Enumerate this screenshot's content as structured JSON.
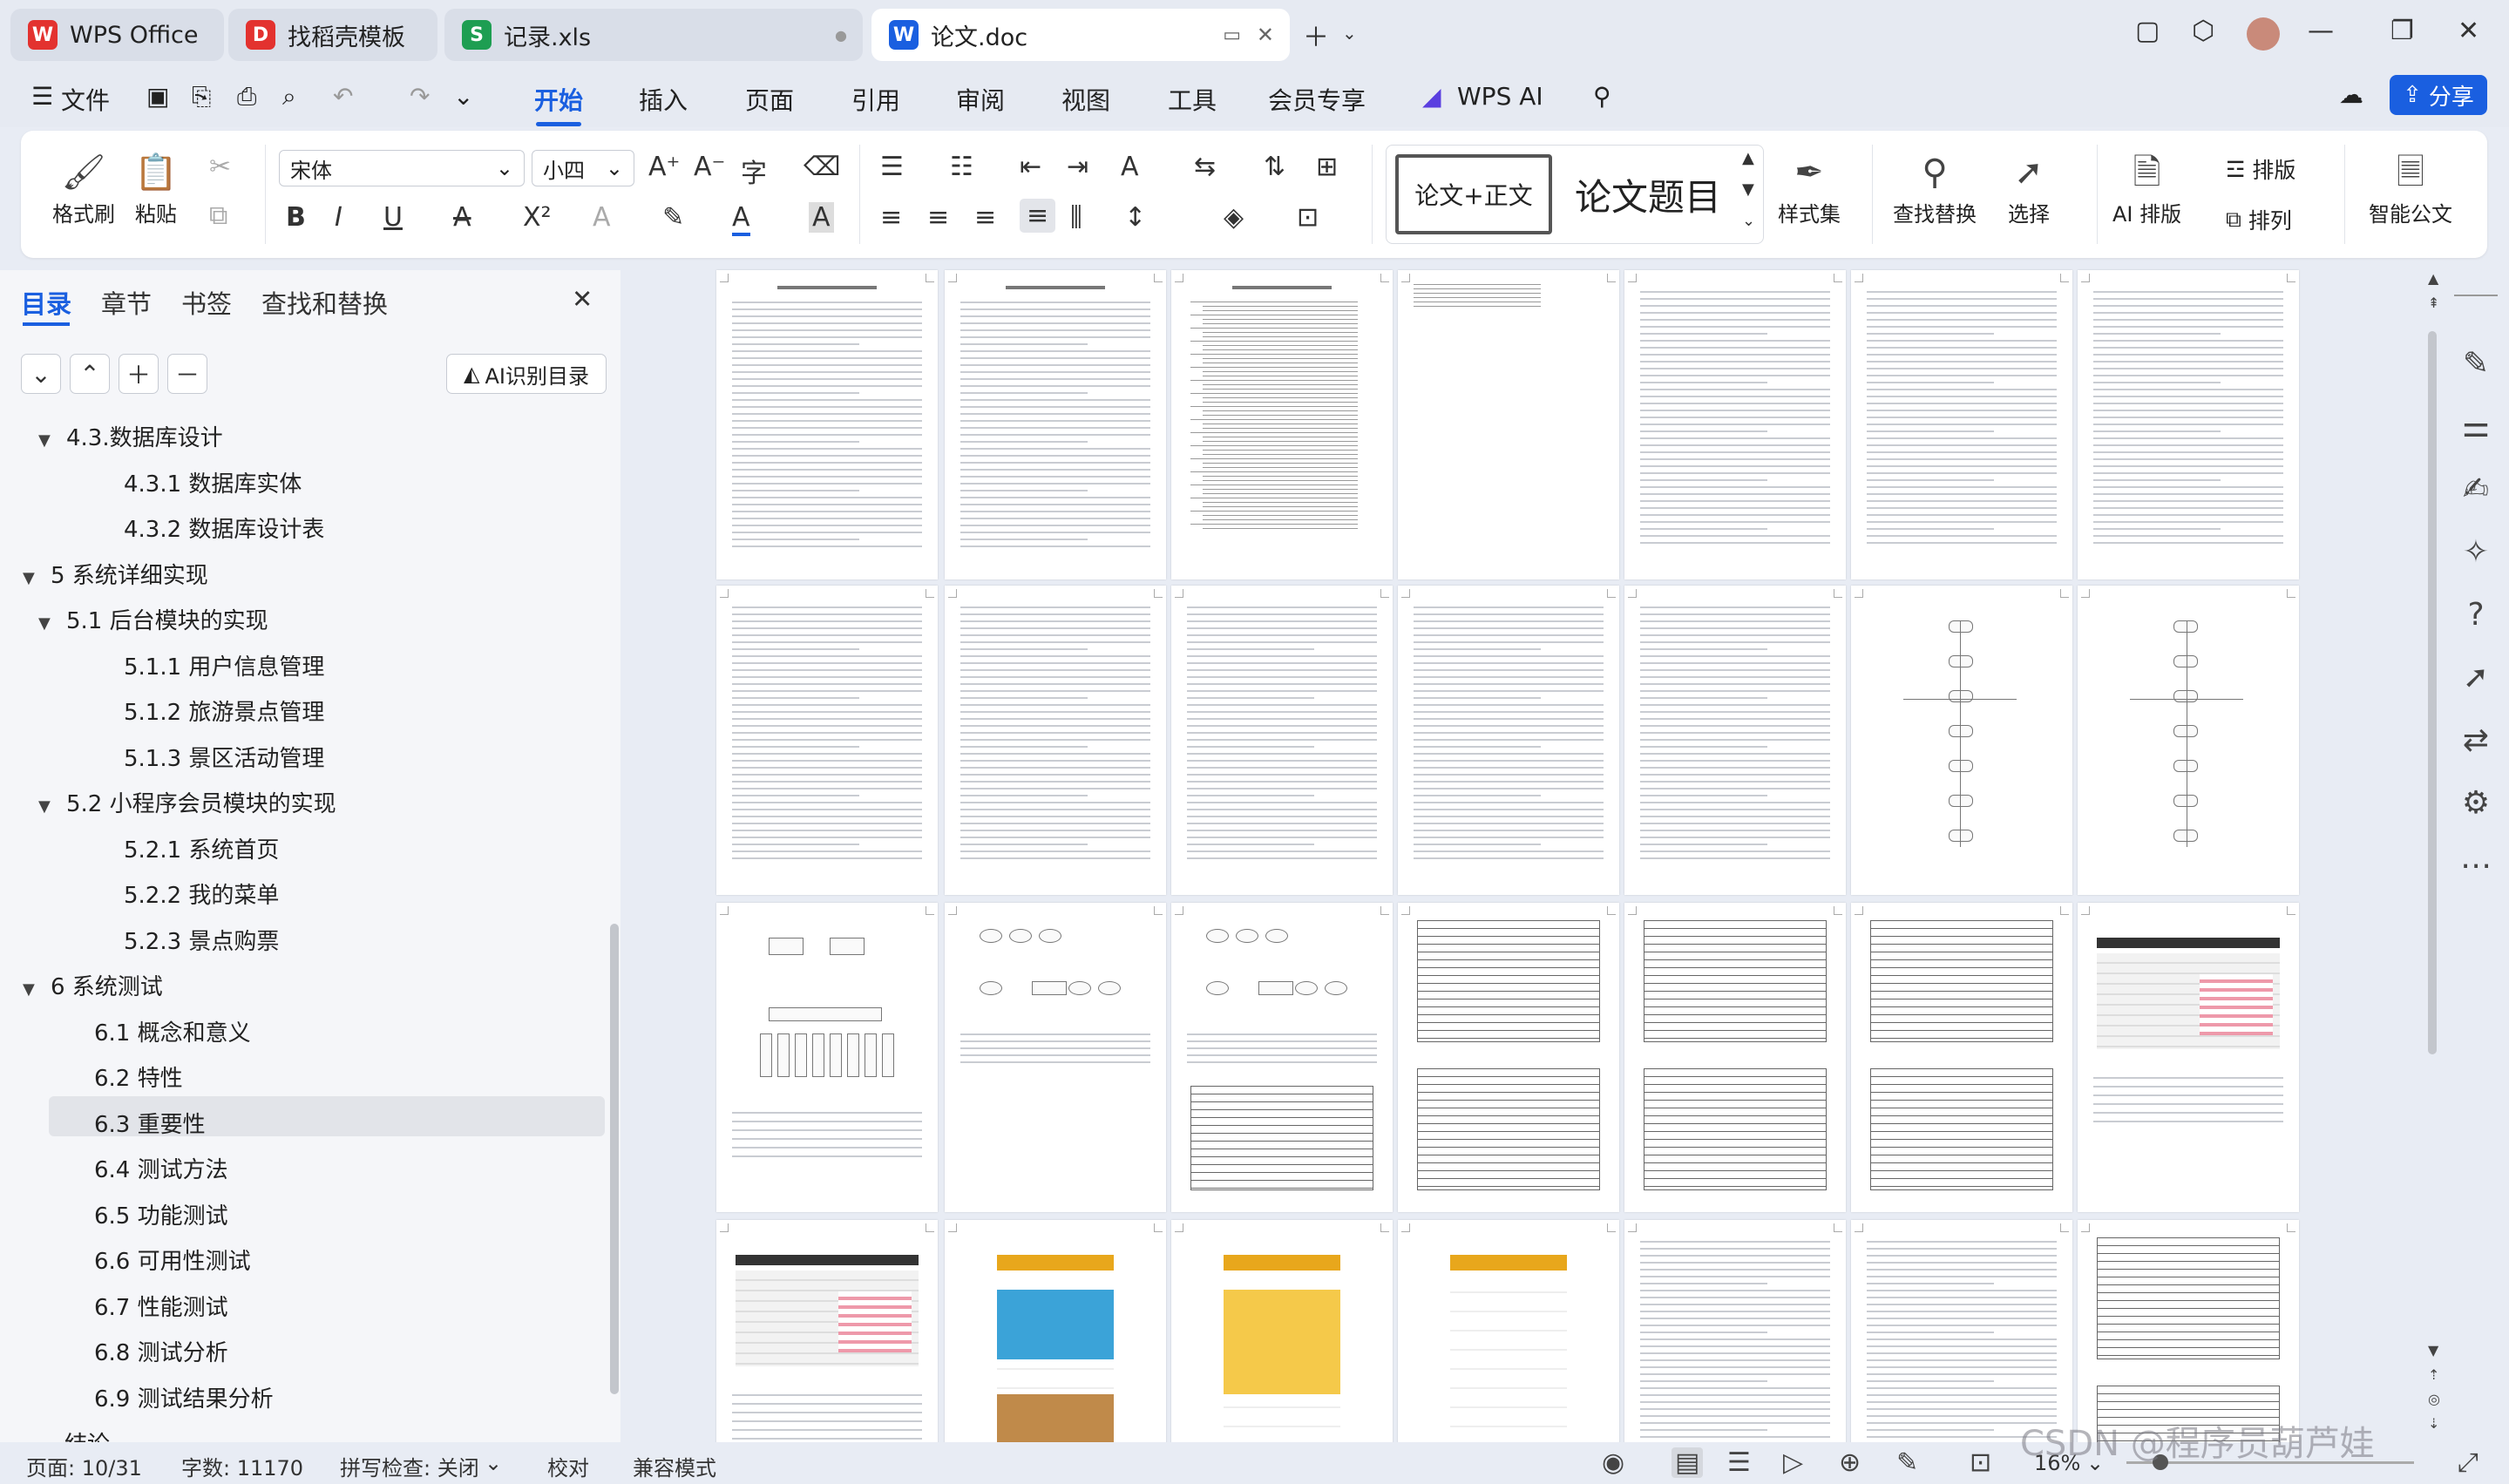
{
  "tabs": [
    {
      "label": "WPS Office",
      "icon": "W",
      "color": "#e3322f"
    },
    {
      "label": "找稻壳模板",
      "icon": "D",
      "color": "#e3322f"
    },
    {
      "label": "记录.xls",
      "icon": "S",
      "color": "#1e9e52"
    },
    {
      "label": "论文.doc",
      "icon": "W",
      "color": "#1a5fe0"
    }
  ],
  "menu": {
    "file": "文件",
    "items": [
      "开始",
      "插入",
      "页面",
      "引用",
      "审阅",
      "视图",
      "工具",
      "会员专享"
    ],
    "wps_ai": "WPS AI",
    "share": "分享"
  },
  "ribbon": {
    "format_painter": "格式刷",
    "paste": "粘贴",
    "font_name": "宋体",
    "font_size": "小四",
    "style_normal": "论文+正文",
    "style_title": "论文题目",
    "styles": "样式集",
    "find_replace": "查找替换",
    "select": "选择",
    "ai_layout": "AI 排版",
    "layout": "排版",
    "arrange": "排列",
    "smart_doc": "智能公文"
  },
  "sidebar": {
    "tabs": [
      "目录",
      "章节",
      "书签",
      "查找和替换"
    ],
    "ai_toc": "AI识别目录",
    "items": [
      {
        "label": "4.3.数据库设计",
        "level": 1,
        "toggle": "▼"
      },
      {
        "label": "4.3.1 数据库实体",
        "level": 2,
        "toggle": ""
      },
      {
        "label": "4.3.2 数据库设计表",
        "level": 2,
        "toggle": ""
      },
      {
        "label": "5 系统详细实现",
        "level": 0,
        "toggle": "▼"
      },
      {
        "label": "5.1  后台模块的实现",
        "level": 1,
        "toggle": "▼"
      },
      {
        "label": "5.1.1  用户信息管理",
        "level": 2,
        "toggle": ""
      },
      {
        "label": "5.1.2  旅游景点管理",
        "level": 2,
        "toggle": ""
      },
      {
        "label": "5.1.3  景区活动管理",
        "level": 2,
        "toggle": ""
      },
      {
        "label": "5.2  小程序会员模块的实现",
        "level": 1,
        "toggle": "▼"
      },
      {
        "label": "5.2.1  系统首页",
        "level": 2,
        "toggle": ""
      },
      {
        "label": "5.2.2  我的菜单",
        "level": 2,
        "toggle": ""
      },
      {
        "label": "5.2.3  景点购票",
        "level": 2,
        "toggle": ""
      },
      {
        "label": "6 系统测试",
        "level": 0,
        "toggle": "▼"
      },
      {
        "label": "6.1 概念和意义",
        "level": 1,
        "toggle": ""
      },
      {
        "label": "6.2 特性",
        "level": 1,
        "toggle": ""
      },
      {
        "label": "6.3 重要性",
        "level": 1,
        "toggle": "",
        "selected": true
      },
      {
        "label": "6.4 测试方法",
        "level": 1,
        "toggle": ""
      },
      {
        "label": "6.5  功能测试",
        "level": 1,
        "toggle": ""
      },
      {
        "label": "6.6 可用性测试",
        "level": 1,
        "toggle": ""
      },
      {
        "label": "6.7 性能测试",
        "level": 1,
        "toggle": ""
      },
      {
        "label": "6.8 测试分析",
        "level": 1,
        "toggle": ""
      },
      {
        "label": "6.9 测试结果分析",
        "level": 1,
        "toggle": ""
      },
      {
        "label": "结论",
        "level": 0,
        "toggle": ""
      }
    ]
  },
  "status": {
    "page": "页面: 10/31",
    "words": "字数: 11170",
    "spell": "拼写检查: 关闭",
    "proof": "校对",
    "compat": "兼容模式",
    "zoom": "16%"
  },
  "watermark": "CSDN @程序员葫芦娃",
  "colors": {
    "accent": "#1a5fe0",
    "tab_bar": "#e6eaf2"
  }
}
